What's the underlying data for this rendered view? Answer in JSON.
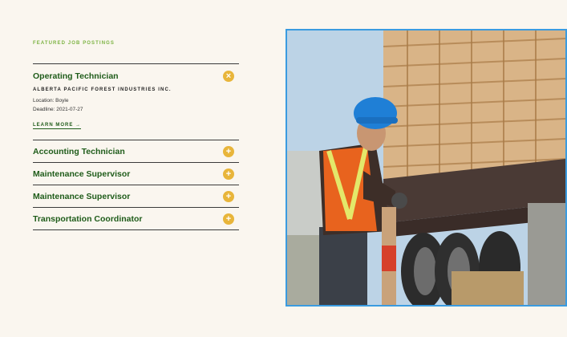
{
  "section_label": "FEATURED JOB POSTINGS",
  "jobs": [
    {
      "title": "Operating Technician",
      "expanded": true,
      "company": "ALBERTA PACIFIC FOREST INDUSTRIES INC.",
      "location": "Location: Boyle",
      "deadline": "Deadline: 2021-07-27",
      "learn_more": "LEARN MORE →"
    },
    {
      "title": "Accounting Technician",
      "expanded": false
    },
    {
      "title": "Maintenance Supervisor",
      "expanded": false
    },
    {
      "title": "Maintenance Supervisor",
      "expanded": false
    },
    {
      "title": "Transportation Coordinator",
      "expanded": false
    }
  ],
  "icons": {
    "expanded": "close-circle-icon",
    "collapsed": "plus-circle-icon"
  },
  "colors": {
    "accent_green": "#1f5c1a",
    "label_green": "#7cb342",
    "toggle_yellow": "#e8b53a",
    "frame_blue": "#3a9be0",
    "background": "#faf6ef"
  }
}
